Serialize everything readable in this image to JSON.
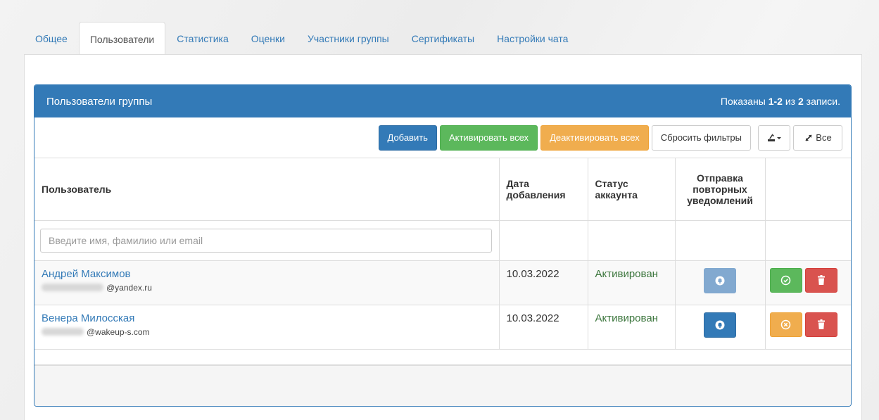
{
  "tabs": [
    {
      "label": "Общее",
      "active": false
    },
    {
      "label": "Пользователи",
      "active": true
    },
    {
      "label": "Статистика",
      "active": false
    },
    {
      "label": "Оценки",
      "active": false
    },
    {
      "label": "Участники группы",
      "active": false
    },
    {
      "label": "Сертификаты",
      "active": false
    },
    {
      "label": "Настройки чата",
      "active": false
    }
  ],
  "panel": {
    "title": "Пользователи группы",
    "summary_prefix": "Показаны ",
    "summary_range": "1-2",
    "summary_mid": " из ",
    "summary_total": "2",
    "summary_suffix": " записи."
  },
  "toolbar": {
    "add": "Добавить",
    "activate_all": "Активировать всех",
    "deactivate_all": "Деактивировать всех",
    "reset_filters": "Сбросить фильтры",
    "export_icon": "export-icon",
    "expand_label": "Все"
  },
  "columns": {
    "user": "Пользователь",
    "date_line1": "Дата",
    "date_line2": "добавления",
    "status_line1": "Статус",
    "status_line2": "аккаунта",
    "resend_line1": "Отправка",
    "resend_line2": "повторных",
    "resend_line3": "уведомлений"
  },
  "filter": {
    "placeholder": "Введите имя, фамилию или email"
  },
  "rows": [
    {
      "name": "Андрей Максимов",
      "email": "@yandex.ru",
      "date": "10.03.2022",
      "status": "Активирован",
      "toggle": "activate"
    },
    {
      "name": "Венера Милосская",
      "email": "@wakeup-s.com",
      "date": "10.03.2022",
      "status": "Активирован",
      "toggle": "deactivate"
    }
  ],
  "colors": {
    "primary": "#337ab7",
    "success": "#5cb85c",
    "warning": "#f0ad4e",
    "danger": "#d9534f",
    "status_ok": "#3c763d"
  }
}
